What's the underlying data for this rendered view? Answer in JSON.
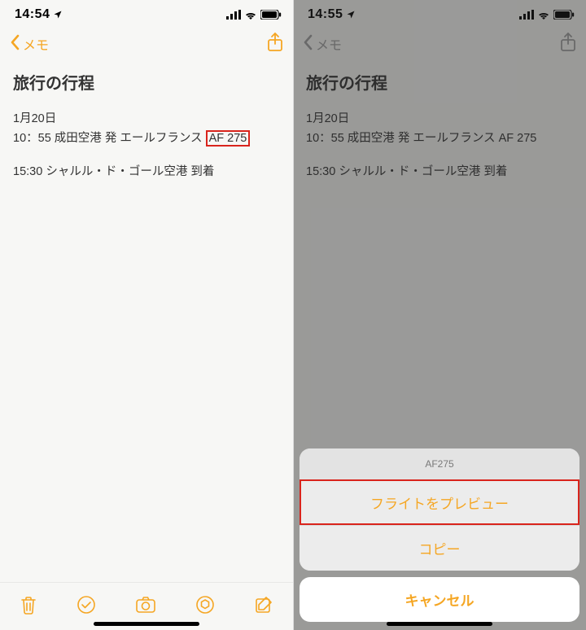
{
  "left": {
    "status_time": "14:54",
    "nav_back": "メモ",
    "note": {
      "title": "旅行の行程",
      "line1": "1月20日",
      "line2_a": "10：55  成田空港 発   エールフランス ",
      "line2_flight": "AF 275",
      "line3": "15:30  シャルル・ド・ゴール空港 到着"
    }
  },
  "right": {
    "status_time": "14:55",
    "nav_back": "メモ",
    "note": {
      "title": "旅行の行程",
      "line1": "1月20日",
      "line2": "10：55  成田空港 発   エールフランス AF 275",
      "line3": "15:30  シャルル・ド・ゴール空港 到着"
    },
    "sheet": {
      "header": "AF275",
      "preview": "フライトをプレビュー",
      "copy": "コピー",
      "cancel": "キャンセル"
    }
  }
}
